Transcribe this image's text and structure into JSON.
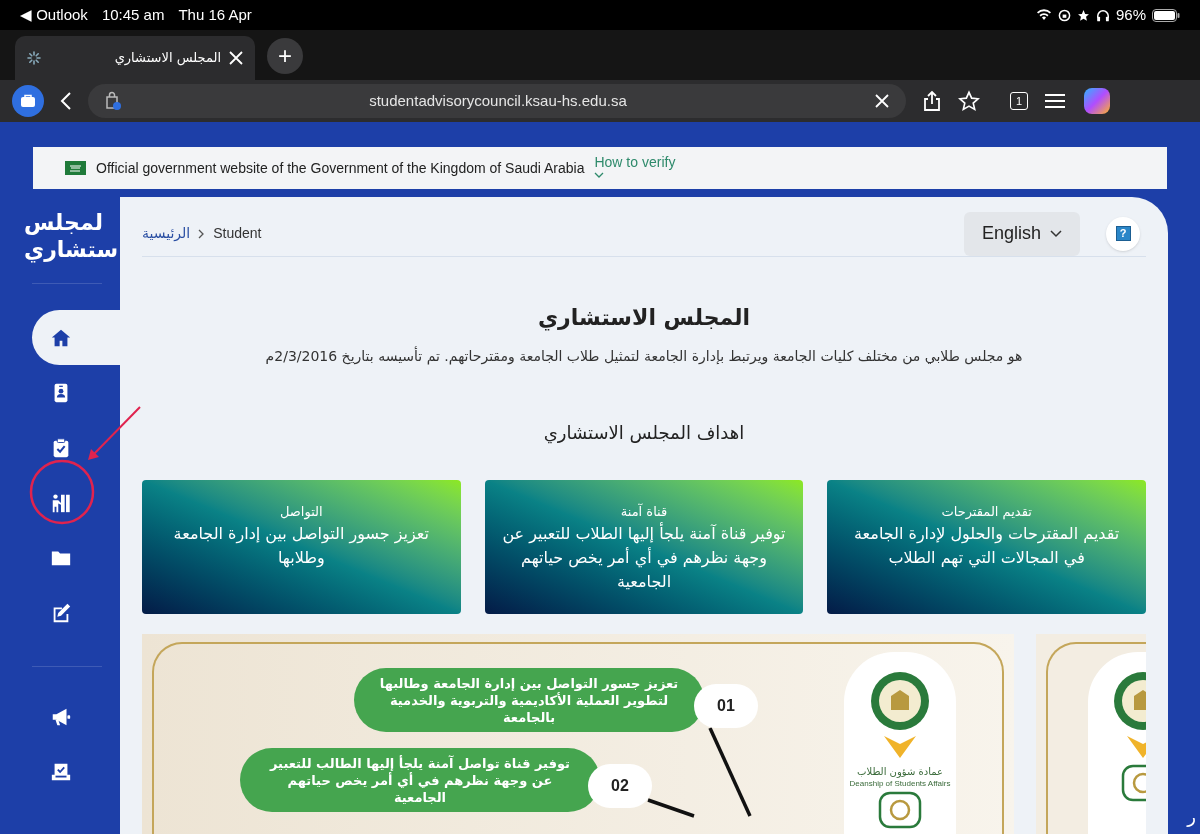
{
  "status_bar": {
    "back_app": "◀ Outlook",
    "time": "10:45 am",
    "date": "Thu 16 Apr",
    "battery": "96%"
  },
  "browser": {
    "tab": {
      "title": "المجلس الاستشاري"
    },
    "new_tab": "+",
    "address": "studentadvisorycouncil.ksau-hs.edu.sa",
    "tab_count": "1"
  },
  "gov_banner": {
    "text": "Official government website of the Government of the Kingdom of Saudi Arabia",
    "link": "How to verify"
  },
  "sidebar": {
    "logo_lines": [
      "لمجلس",
      "ستشاري"
    ],
    "groups": [
      [
        {
          "kind": "home",
          "selected": true
        },
        {
          "kind": "id-card",
          "selected": false
        },
        {
          "kind": "clipboard",
          "selected": false
        },
        {
          "kind": "teacher",
          "selected": false
        },
        {
          "kind": "folder",
          "selected": false
        },
        {
          "kind": "edit",
          "selected": false
        }
      ],
      [
        {
          "kind": "megaphone",
          "selected": false
        },
        {
          "kind": "ballot",
          "selected": false
        }
      ]
    ]
  },
  "header": {
    "breadcrumb": [
      "Student",
      "الرئيسية"
    ],
    "language": "English",
    "help": "?"
  },
  "hero": {
    "title": "المجلس الاستشاري",
    "description": "هو مجلس طلابي من مختلف كليات الجامعة ويرتبط بإدارة الجامعة لتمثيل طلاب الجامعة ومقترحاتهم. تم تأسيسه بتاريخ 2/3/2016م"
  },
  "goals": {
    "title": "اهداف المجلس الاستشاري",
    "cards": [
      {
        "title": "تقديم المقترحات",
        "text": "تقديم المقترحات والحلول لإدارة الجامعة في المجالات التي تهم الطلاب"
      },
      {
        "title": "قناة آمنة",
        "text": "توفير قناة آمنة يلجأ إليها الطلاب للتعبير عن وجهة نظرهم في أي أمر يخص حياتهم الجامعية"
      },
      {
        "title": "التواصل",
        "text": "تعزيز جسور التواصل بين إدارة الجامعة وطلابها"
      }
    ]
  },
  "infographic": {
    "items": [
      {
        "number": "01",
        "text": "تعزيز جسور التواصل بين إدارة الجامعة وطالبها لتطوير العملية الأكاديمية والتربوية والخدمية بالجامعة"
      },
      {
        "number": "02",
        "text": "توفير قناة تواصل آمنة يلجأ إليها الطالب للتعبير عن وجهة نظرهم في أي أمر يخص حياتهم الجامعية"
      }
    ],
    "logo_caption": "عمادة شؤون الطلاب",
    "logo_caption_en": "Deanship of Students Affairs"
  },
  "edge_text": "ر"
}
